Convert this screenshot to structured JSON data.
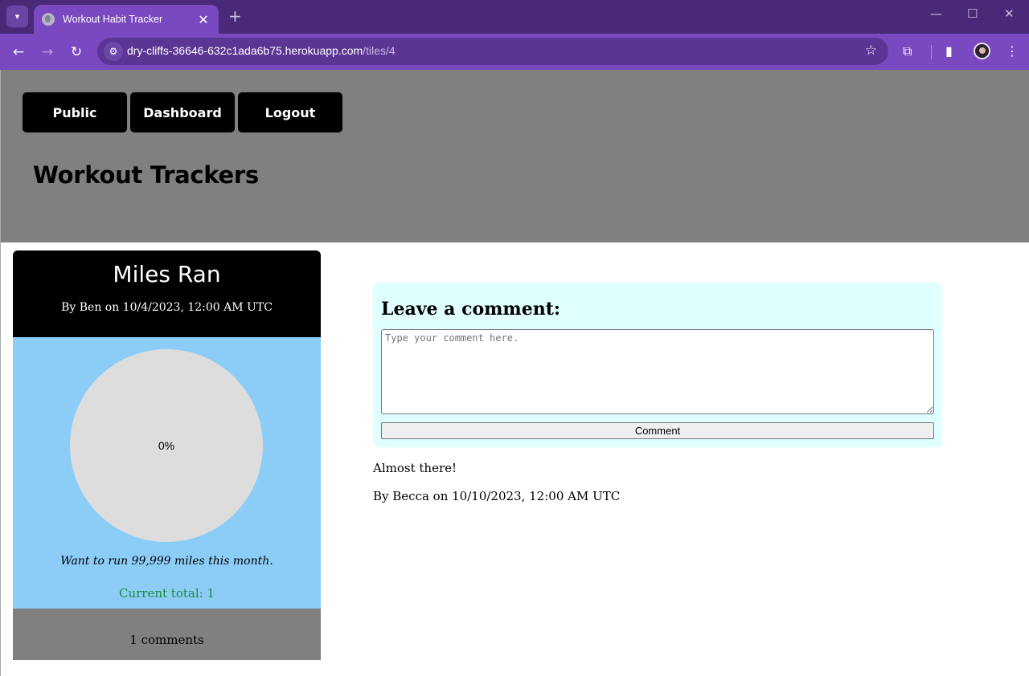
{
  "browser": {
    "tab_title": "Workout Habit Tracker",
    "url_host": "dry-cliffs-36646-632c1ada6b75.herokuapp.com",
    "url_path": "/tiles/4",
    "icons": {
      "tab_menu": "chevron-down-icon",
      "favicon": "globe-icon",
      "tab_close": "close-icon",
      "new_tab": "plus-icon",
      "back": "arrow-left-icon",
      "forward": "arrow-right-icon",
      "reload": "reload-icon",
      "site_info": "tune-icon",
      "bookmark": "star-icon",
      "extensions": "puzzle-icon",
      "side_panel": "side-panel-icon",
      "profile": "avatar",
      "menu": "kebab-menu-icon"
    },
    "colors": {
      "frame": "#4a2a78",
      "toolbar": "#7a48c0",
      "omnibox": "#5b3594"
    }
  },
  "nav": {
    "public": "Public",
    "dashboard": "Dashboard",
    "logout": "Logout"
  },
  "site_title": "Workout Trackers",
  "tile": {
    "title": "Miles Ran",
    "byline": "By Ben on 10/4/2023, 12:00 AM UTC",
    "progress_label": "0%",
    "progress_value": 0,
    "goal": "Want to run 99,999 miles this month.",
    "current_total": "Current total: 1",
    "comments_count": "1 comments",
    "colors": {
      "header": "#000000",
      "body": "#8ccdf8",
      "progress": "#dddddd",
      "footer": "#808080",
      "total_text": "#1f8a3a"
    }
  },
  "comment_form": {
    "heading": "Leave a comment:",
    "placeholder": "Type your comment here.",
    "submit_label": "Comment",
    "background": "#e0ffff"
  },
  "comments": [
    {
      "text": "Almost there!",
      "meta": "By Becca on 10/10/2023, 12:00 AM UTC"
    }
  ]
}
